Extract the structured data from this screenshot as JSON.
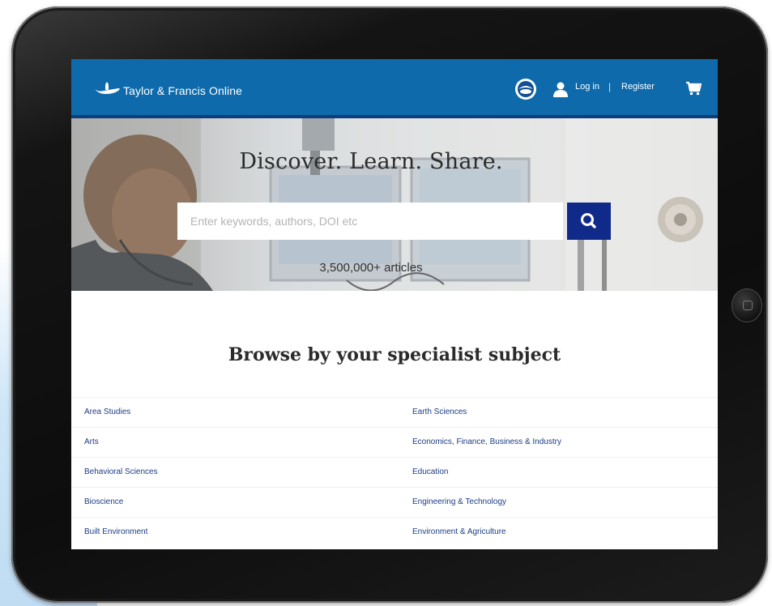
{
  "header": {
    "brand": "Taylor & Francis Online",
    "login_label": "Log in",
    "separator": "|",
    "register_label": "Register"
  },
  "hero": {
    "title": "Discover. Learn. Share.",
    "search_placeholder": "Enter keywords, authors, DOI etc",
    "article_count": "3,500,000+ articles"
  },
  "browse": {
    "title": "Browse by your specialist subject",
    "rows": [
      {
        "left": "Area Studies",
        "right": "Earth Sciences"
      },
      {
        "left": "Arts",
        "right": "Economics, Finance, Business & Industry"
      },
      {
        "left": "Behavioral Sciences",
        "right": "Education"
      },
      {
        "left": "Bioscience",
        "right": "Engineering & Technology"
      },
      {
        "left": "Built Environment",
        "right": "Environment & Agriculture"
      }
    ]
  },
  "colors": {
    "header_blue": "#0e6aaa",
    "header_border": "#0a3e7e",
    "search_button": "#102a8a",
    "link_color": "#1c3d84"
  },
  "icons": {
    "logo": "lamp-icon",
    "globe": "globe-icon",
    "user": "user-icon",
    "cart": "cart-icon",
    "search": "search-icon"
  }
}
